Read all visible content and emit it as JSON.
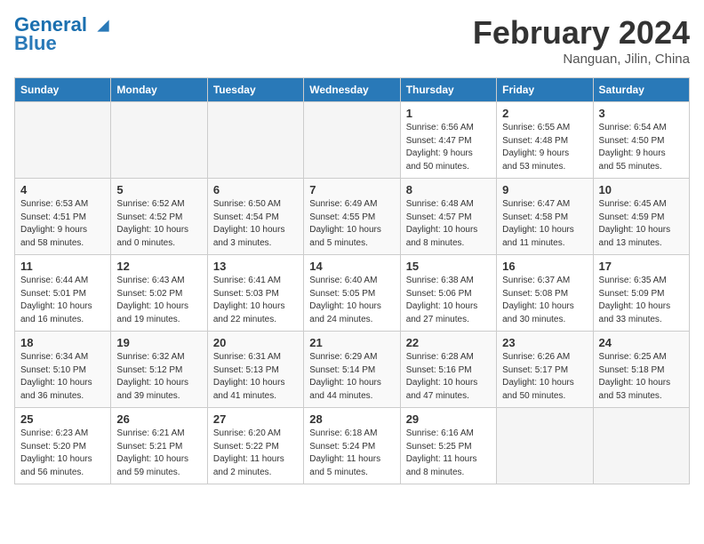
{
  "header": {
    "logo_line1": "General",
    "logo_line2": "Blue",
    "month_title": "February 2024",
    "location": "Nanguan, Jilin, China"
  },
  "weekdays": [
    "Sunday",
    "Monday",
    "Tuesday",
    "Wednesday",
    "Thursday",
    "Friday",
    "Saturday"
  ],
  "weeks": [
    [
      {
        "day": "",
        "detail": ""
      },
      {
        "day": "",
        "detail": ""
      },
      {
        "day": "",
        "detail": ""
      },
      {
        "day": "",
        "detail": ""
      },
      {
        "day": "1",
        "detail": "Sunrise: 6:56 AM\nSunset: 4:47 PM\nDaylight: 9 hours\nand 50 minutes."
      },
      {
        "day": "2",
        "detail": "Sunrise: 6:55 AM\nSunset: 4:48 PM\nDaylight: 9 hours\nand 53 minutes."
      },
      {
        "day": "3",
        "detail": "Sunrise: 6:54 AM\nSunset: 4:50 PM\nDaylight: 9 hours\nand 55 minutes."
      }
    ],
    [
      {
        "day": "4",
        "detail": "Sunrise: 6:53 AM\nSunset: 4:51 PM\nDaylight: 9 hours\nand 58 minutes."
      },
      {
        "day": "5",
        "detail": "Sunrise: 6:52 AM\nSunset: 4:52 PM\nDaylight: 10 hours\nand 0 minutes."
      },
      {
        "day": "6",
        "detail": "Sunrise: 6:50 AM\nSunset: 4:54 PM\nDaylight: 10 hours\nand 3 minutes."
      },
      {
        "day": "7",
        "detail": "Sunrise: 6:49 AM\nSunset: 4:55 PM\nDaylight: 10 hours\nand 5 minutes."
      },
      {
        "day": "8",
        "detail": "Sunrise: 6:48 AM\nSunset: 4:57 PM\nDaylight: 10 hours\nand 8 minutes."
      },
      {
        "day": "9",
        "detail": "Sunrise: 6:47 AM\nSunset: 4:58 PM\nDaylight: 10 hours\nand 11 minutes."
      },
      {
        "day": "10",
        "detail": "Sunrise: 6:45 AM\nSunset: 4:59 PM\nDaylight: 10 hours\nand 13 minutes."
      }
    ],
    [
      {
        "day": "11",
        "detail": "Sunrise: 6:44 AM\nSunset: 5:01 PM\nDaylight: 10 hours\nand 16 minutes."
      },
      {
        "day": "12",
        "detail": "Sunrise: 6:43 AM\nSunset: 5:02 PM\nDaylight: 10 hours\nand 19 minutes."
      },
      {
        "day": "13",
        "detail": "Sunrise: 6:41 AM\nSunset: 5:03 PM\nDaylight: 10 hours\nand 22 minutes."
      },
      {
        "day": "14",
        "detail": "Sunrise: 6:40 AM\nSunset: 5:05 PM\nDaylight: 10 hours\nand 24 minutes."
      },
      {
        "day": "15",
        "detail": "Sunrise: 6:38 AM\nSunset: 5:06 PM\nDaylight: 10 hours\nand 27 minutes."
      },
      {
        "day": "16",
        "detail": "Sunrise: 6:37 AM\nSunset: 5:08 PM\nDaylight: 10 hours\nand 30 minutes."
      },
      {
        "day": "17",
        "detail": "Sunrise: 6:35 AM\nSunset: 5:09 PM\nDaylight: 10 hours\nand 33 minutes."
      }
    ],
    [
      {
        "day": "18",
        "detail": "Sunrise: 6:34 AM\nSunset: 5:10 PM\nDaylight: 10 hours\nand 36 minutes."
      },
      {
        "day": "19",
        "detail": "Sunrise: 6:32 AM\nSunset: 5:12 PM\nDaylight: 10 hours\nand 39 minutes."
      },
      {
        "day": "20",
        "detail": "Sunrise: 6:31 AM\nSunset: 5:13 PM\nDaylight: 10 hours\nand 41 minutes."
      },
      {
        "day": "21",
        "detail": "Sunrise: 6:29 AM\nSunset: 5:14 PM\nDaylight: 10 hours\nand 44 minutes."
      },
      {
        "day": "22",
        "detail": "Sunrise: 6:28 AM\nSunset: 5:16 PM\nDaylight: 10 hours\nand 47 minutes."
      },
      {
        "day": "23",
        "detail": "Sunrise: 6:26 AM\nSunset: 5:17 PM\nDaylight: 10 hours\nand 50 minutes."
      },
      {
        "day": "24",
        "detail": "Sunrise: 6:25 AM\nSunset: 5:18 PM\nDaylight: 10 hours\nand 53 minutes."
      }
    ],
    [
      {
        "day": "25",
        "detail": "Sunrise: 6:23 AM\nSunset: 5:20 PM\nDaylight: 10 hours\nand 56 minutes."
      },
      {
        "day": "26",
        "detail": "Sunrise: 6:21 AM\nSunset: 5:21 PM\nDaylight: 10 hours\nand 59 minutes."
      },
      {
        "day": "27",
        "detail": "Sunrise: 6:20 AM\nSunset: 5:22 PM\nDaylight: 11 hours\nand 2 minutes."
      },
      {
        "day": "28",
        "detail": "Sunrise: 6:18 AM\nSunset: 5:24 PM\nDaylight: 11 hours\nand 5 minutes."
      },
      {
        "day": "29",
        "detail": "Sunrise: 6:16 AM\nSunset: 5:25 PM\nDaylight: 11 hours\nand 8 minutes."
      },
      {
        "day": "",
        "detail": ""
      },
      {
        "day": "",
        "detail": ""
      }
    ]
  ]
}
